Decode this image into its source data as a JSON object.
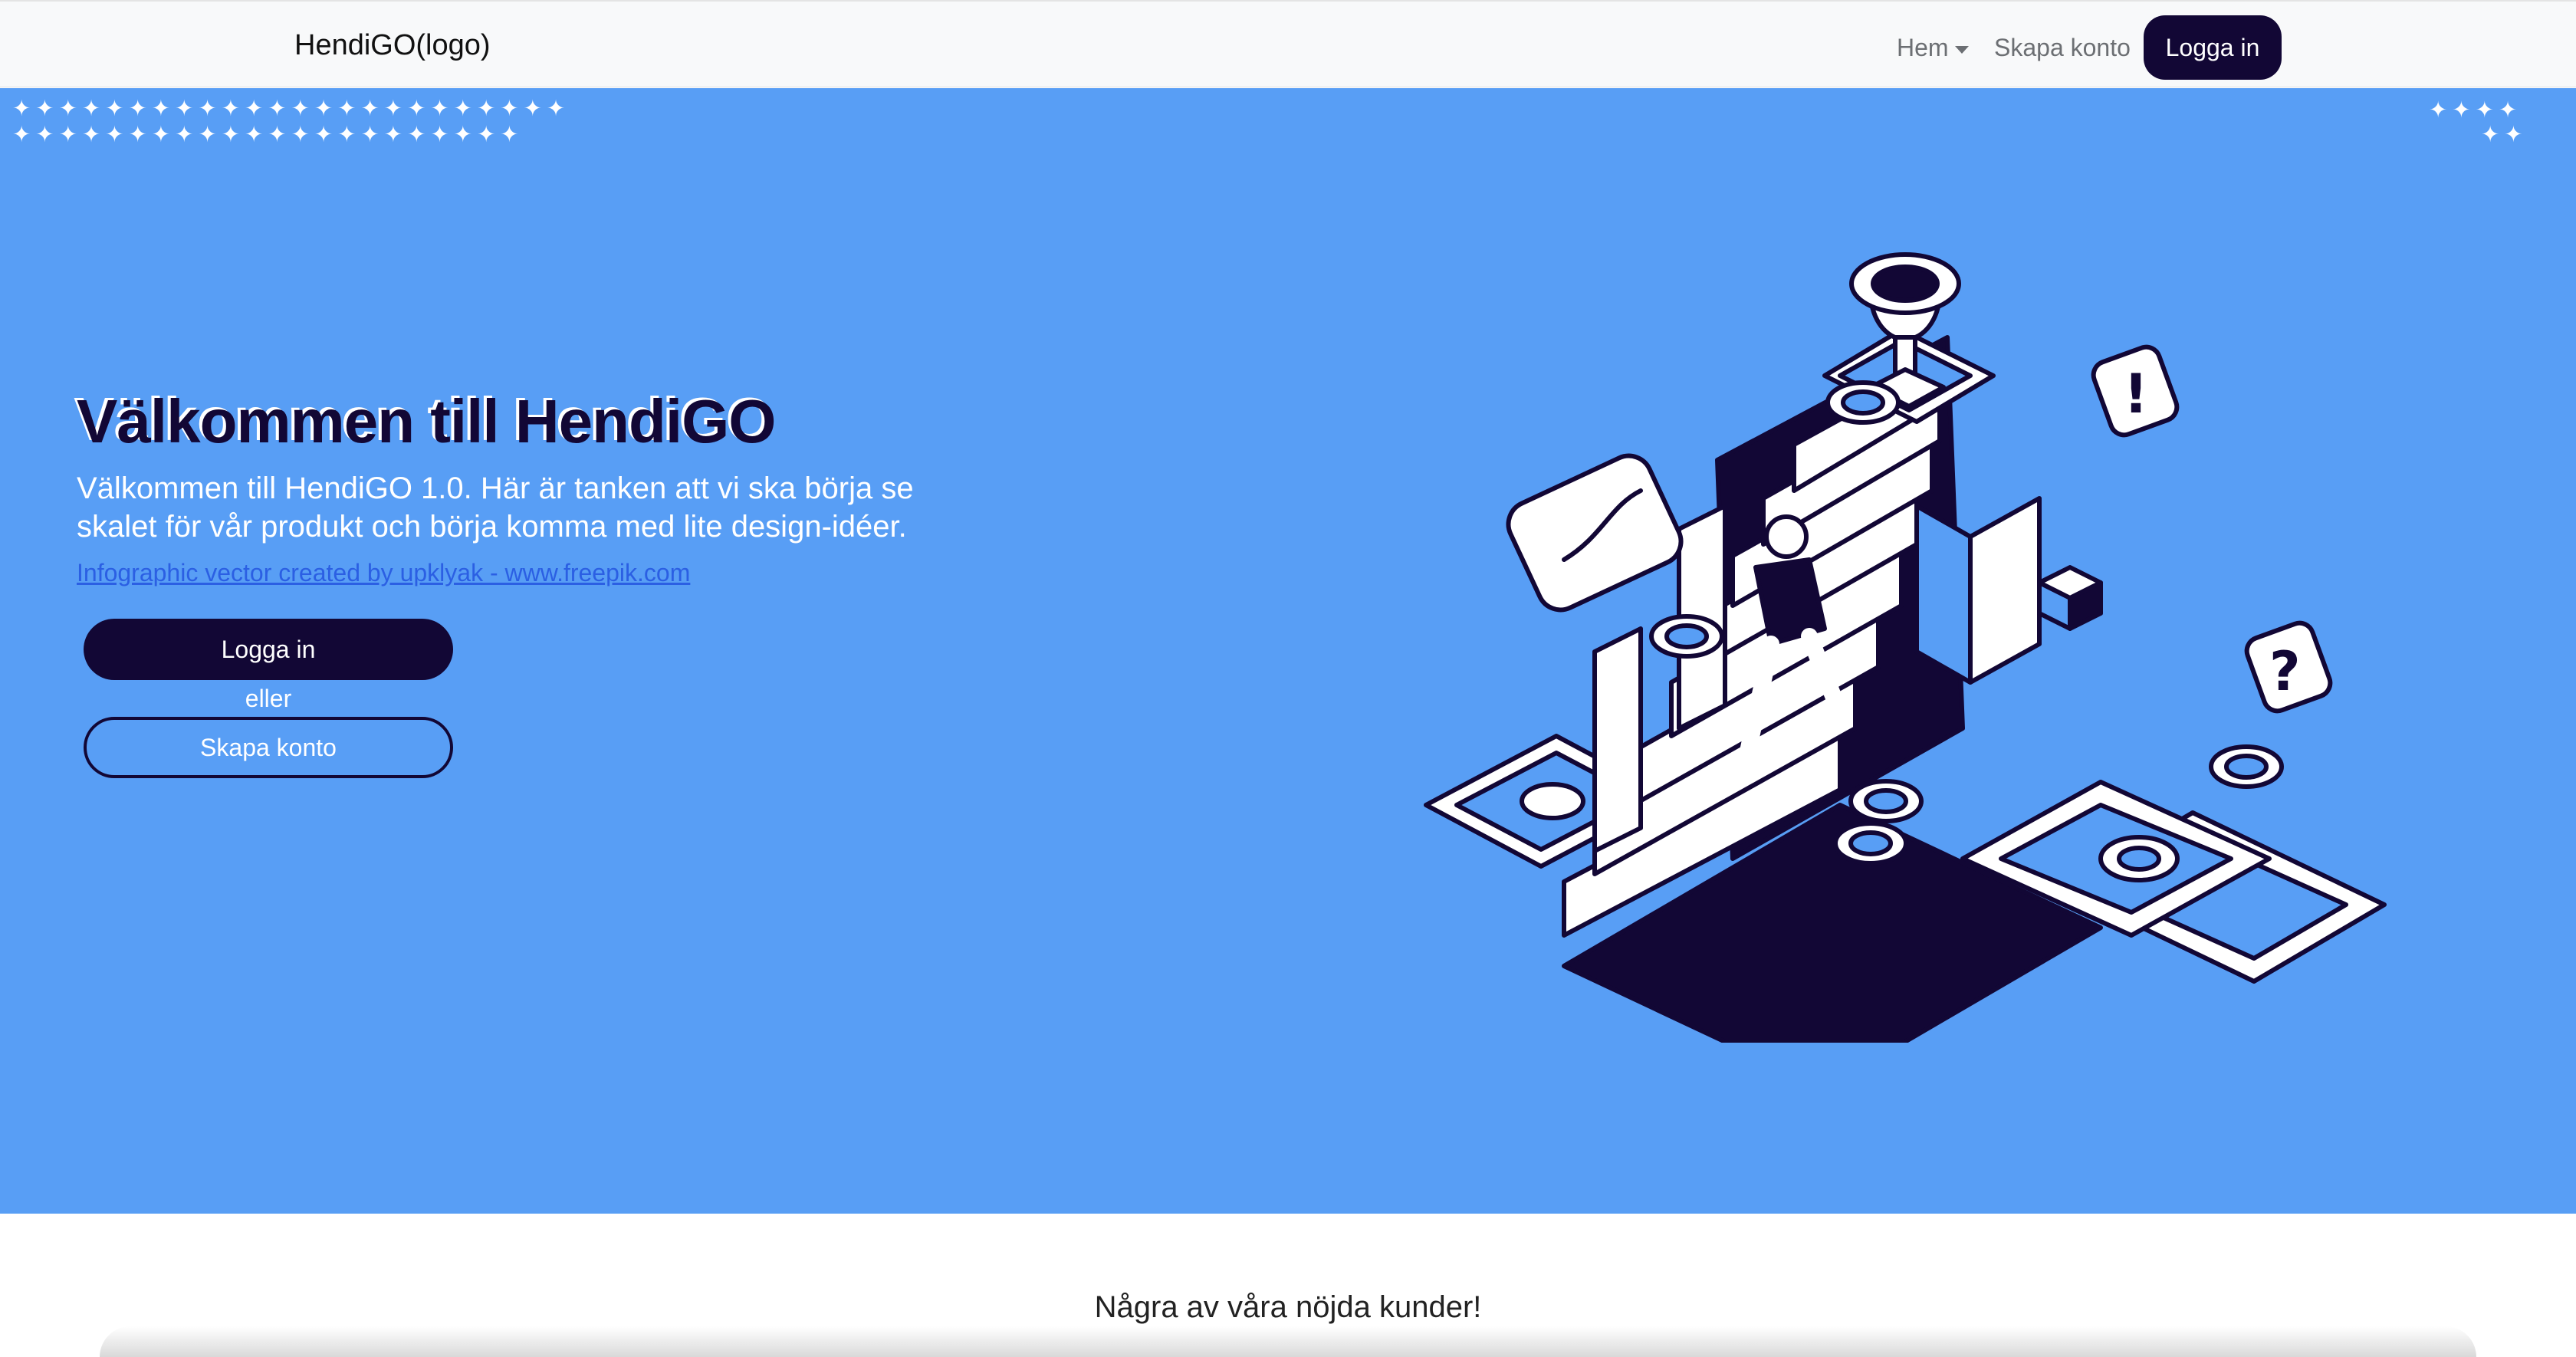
{
  "navbar": {
    "brand": "HendiGO(logo)",
    "items": [
      {
        "label": "Hem",
        "dropdown": true
      },
      {
        "label": "Skapa konto"
      }
    ],
    "login_button": "Logga in"
  },
  "hero": {
    "background": "#589ef5",
    "accent": "#120735",
    "title": "Välkommen till HendiGO",
    "description": "Välkommen till HendiGO 1.0. Här är tanken att vi ska börja se skalet för vår produkt och börja komma med lite design-idéer.",
    "credit_link": "Infographic vector created by upklyak - www.freepik.com",
    "login_button": "Logga in",
    "or_text": "eller",
    "signup_button": "Skapa konto",
    "illustration_icon": "stairs-trophy-illustration"
  },
  "customers": {
    "title": "Några av våra nöjda kunder!"
  }
}
